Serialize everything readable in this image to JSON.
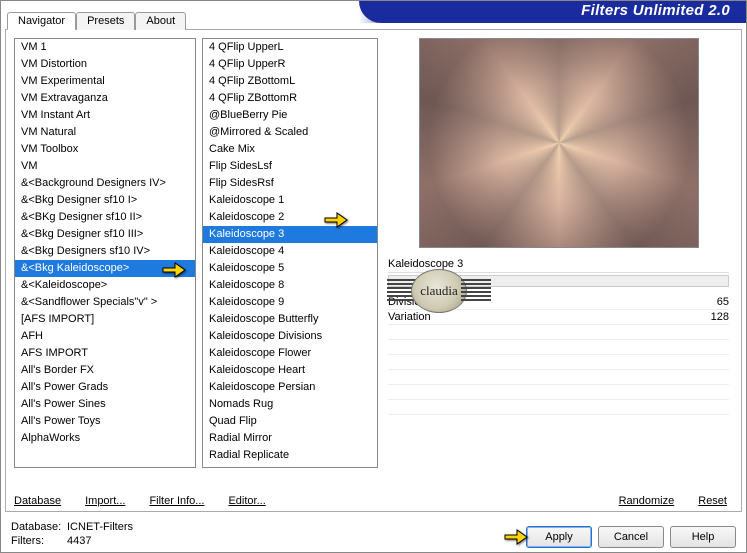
{
  "app_title": "Filters Unlimited 2.0",
  "tabs": [
    "Navigator",
    "Presets",
    "About"
  ],
  "active_tab": 0,
  "list1": [
    "VM 1",
    "VM Distortion",
    "VM Experimental",
    "VM Extravaganza",
    "VM Instant Art",
    "VM Natural",
    "VM Toolbox",
    "VM",
    "&<Background Designers IV>",
    "&<Bkg Designer sf10 I>",
    "&<BKg Designer sf10 II>",
    "&<Bkg Designer sf10 III>",
    "&<Bkg Designers sf10 IV>",
    "&<Bkg Kaleidoscope>",
    "&<Kaleidoscope>",
    "&<Sandflower Specials\"v\" >",
    "[AFS IMPORT]",
    "AFH",
    "AFS IMPORT",
    "All's Border FX",
    "All's Power Grads",
    "All's Power Sines",
    "All's Power Toys",
    "AlphaWorks"
  ],
  "list1_selected_index": 13,
  "list2": [
    "4 QFlip UpperL",
    "4 QFlip UpperR",
    "4 QFlip ZBottomL",
    "4 QFlip ZBottomR",
    "@BlueBerry Pie",
    "@Mirrored & Scaled",
    "Cake Mix",
    "Flip SidesLsf",
    "Flip SidesRsf",
    "Kaleidoscope 1",
    "Kaleidoscope 2",
    "Kaleidoscope 3",
    "Kaleidoscope 4",
    "Kaleidoscope 5",
    "Kaleidoscope 8",
    "Kaleidoscope 9",
    "Kaleidoscope Butterfly",
    "Kaleidoscope Divisions",
    "Kaleidoscope Flower",
    "Kaleidoscope Heart",
    "Kaleidoscope Persian",
    "Nomads Rug",
    "Quad Flip",
    "Radial Mirror",
    "Radial Replicate"
  ],
  "list2_selected_index": 11,
  "bottom_links": {
    "database": "Database",
    "import": "Import...",
    "filter_info": "Filter Info...",
    "editor": "Editor...",
    "randomize": "Randomize",
    "reset": "Reset"
  },
  "filter_name": "Kaleidoscope 3",
  "params": [
    {
      "label": "Divisions",
      "value": "65"
    },
    {
      "label": "Variation",
      "value": "128"
    }
  ],
  "footer": {
    "db_label": "Database:",
    "db_value": "ICNET-Filters",
    "filters_label": "Filters:",
    "filters_value": "4437"
  },
  "buttons": {
    "apply": "Apply",
    "cancel": "Cancel",
    "help": "Help"
  },
  "watermark": "claudia"
}
